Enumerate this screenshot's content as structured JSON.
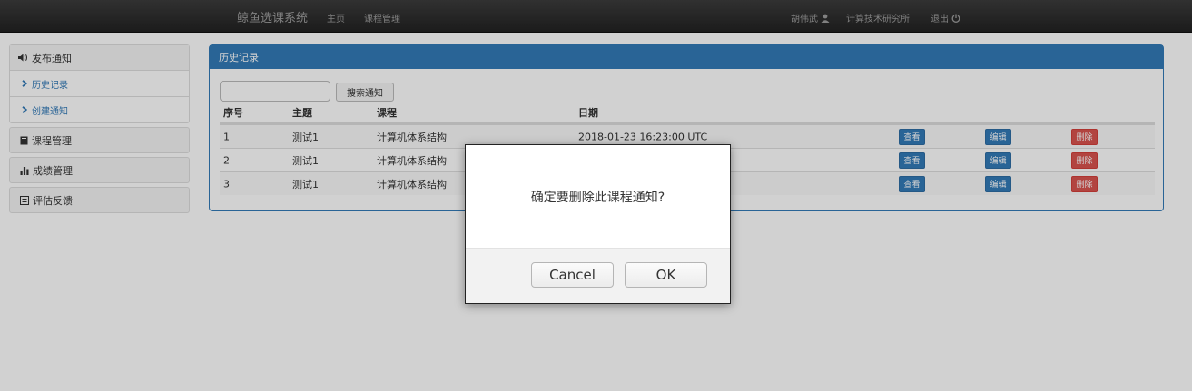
{
  "navbar": {
    "brand": "鲸鱼选课系统",
    "links": [
      "主页",
      "课程管理"
    ],
    "user": "胡伟武",
    "department": "计算技术研究所",
    "logout": "退出"
  },
  "sidebar": {
    "notice": {
      "label": "发布通知",
      "items": [
        "历史记录",
        "创建通知"
      ]
    },
    "course_mgmt": "课程管理",
    "grade_mgmt": "成绩管理",
    "feedback": "评估反馈"
  },
  "main": {
    "title": "历史记录",
    "search_placeholder": "",
    "search_button": "搜索通知",
    "columns": [
      "序号",
      "主题",
      "课程",
      "日期"
    ],
    "rows": [
      {
        "no": "1",
        "subject": "测试1",
        "course": "计算机体系结构",
        "date": "2018-01-23 16:23:00 UTC"
      },
      {
        "no": "2",
        "subject": "测试1",
        "course": "计算机体系结构",
        "date": ""
      },
      {
        "no": "3",
        "subject": "测试1",
        "course": "计算机体系结构",
        "date": ""
      }
    ],
    "actions": {
      "view": "查看",
      "edit": "编辑",
      "delete": "删除"
    }
  },
  "dialog": {
    "message": "确定要删除此课程通知?",
    "cancel": "Cancel",
    "ok": "OK"
  },
  "colors": {
    "primary": "#337ab7",
    "danger": "#d9534f",
    "navbar": "#2b2b2b"
  }
}
